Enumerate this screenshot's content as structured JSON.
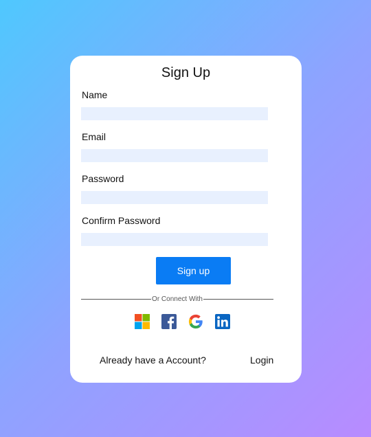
{
  "form": {
    "title": "Sign Up",
    "fields": [
      {
        "label": "Name",
        "value": "",
        "placeholder": ""
      },
      {
        "label": "Email",
        "value": "",
        "placeholder": ""
      },
      {
        "label": "Password",
        "value": "",
        "placeholder": ""
      },
      {
        "label": "Confirm Password",
        "value": "",
        "placeholder": ""
      }
    ],
    "submit_label": "Sign up",
    "divider_text": "Or Connect With",
    "socials": [
      "microsoft-icon",
      "facebook-icon",
      "google-icon",
      "linkedin-icon"
    ],
    "footer": {
      "prompt": "Already have a Account?",
      "login_label": "Login"
    }
  },
  "colors": {
    "accent": "#0a7cf4",
    "input_bg": "#e8f0fe",
    "gradient_start": "#4fc8fe",
    "gradient_end": "#b88bff"
  }
}
